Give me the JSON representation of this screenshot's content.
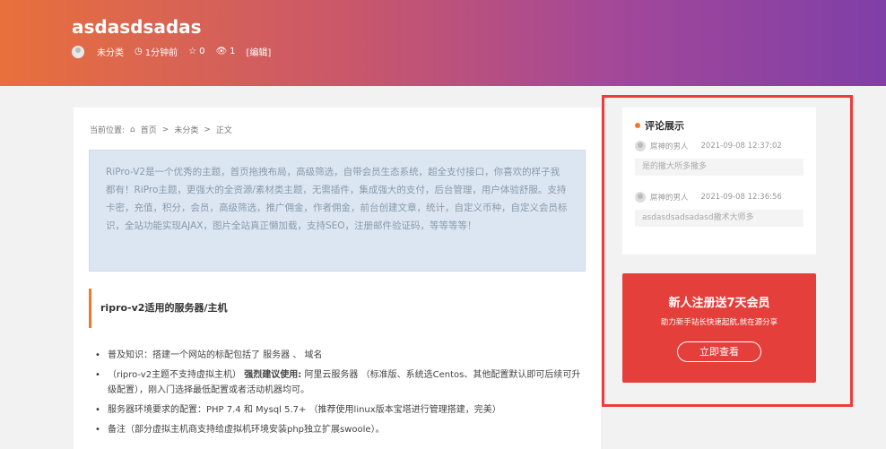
{
  "header": {
    "title": "asdasdsadas",
    "category": "未分类",
    "time": "1分钟前",
    "likes": "0",
    "views": "1",
    "edit": "[编辑]"
  },
  "breadcrumb": {
    "prefix": "当前位置:",
    "home": "首页",
    "sep": ">",
    "category": "未分类",
    "current": "正文"
  },
  "intro_text": "RiPro-V2是一个优秀的主题，首页拖拽布局，高级筛选，自带会员生态系统，超全支付接口，你喜欢的样子我都有！RiPro主题，更强大的全资源/素材类主题，无需插件，集成强大的支付，后台管理，用户体验舒服。支持卡密，充值，积分，会员，高级筛选，推广佣金，作者佣金，前台创建文章，统计，自定义币种，自定义会员标识，全站功能实现AJAX，图片全站真正懒加载，支持SEO，注册邮件验证码，等等等等！",
  "section_heading": "ripro-v2适用的服务器/主机",
  "bullets": [
    {
      "text": "普及知识：搭建一个网站的标配包括了 服务器 、 域名"
    },
    {
      "pre": "（ripro-v2主题不支持虚拟主机）",
      "bold": "强烈建议使用:",
      "post": "阿里云服务器 （标准版、系统选Centos、其他配置默认即可后续可升级配置），刚入门选择最低配置或者活动机器均可。"
    },
    {
      "text": "服务器环境要求的配置：PHP 7.4 和 Mysql 5.7+ （推荐使用linux版本宝塔进行管理搭建，完美）"
    },
    {
      "text": "备注（部分虚拟主机商支持给虚拟机环境安装php独立扩展swoole）。"
    }
  ],
  "sidebar": {
    "title": "评论展示",
    "comments": [
      {
        "author": "屌神的男人",
        "time": "2021-09-08 12:37:02",
        "text": "是的撒大所多撒多"
      },
      {
        "author": "屌神的男人",
        "time": "2021-09-08 12:36:56",
        "text": "asdasdsadsadasd撒术大师多"
      }
    ]
  },
  "promo": {
    "title": "新人注册送7天会员",
    "subtitle": "助力新手站长快速起航,就在源分享",
    "button": "立即查看"
  },
  "colors": {
    "accent": "#f0782f",
    "promo": "#e43f3a",
    "highlight": "#ef3b3b"
  }
}
